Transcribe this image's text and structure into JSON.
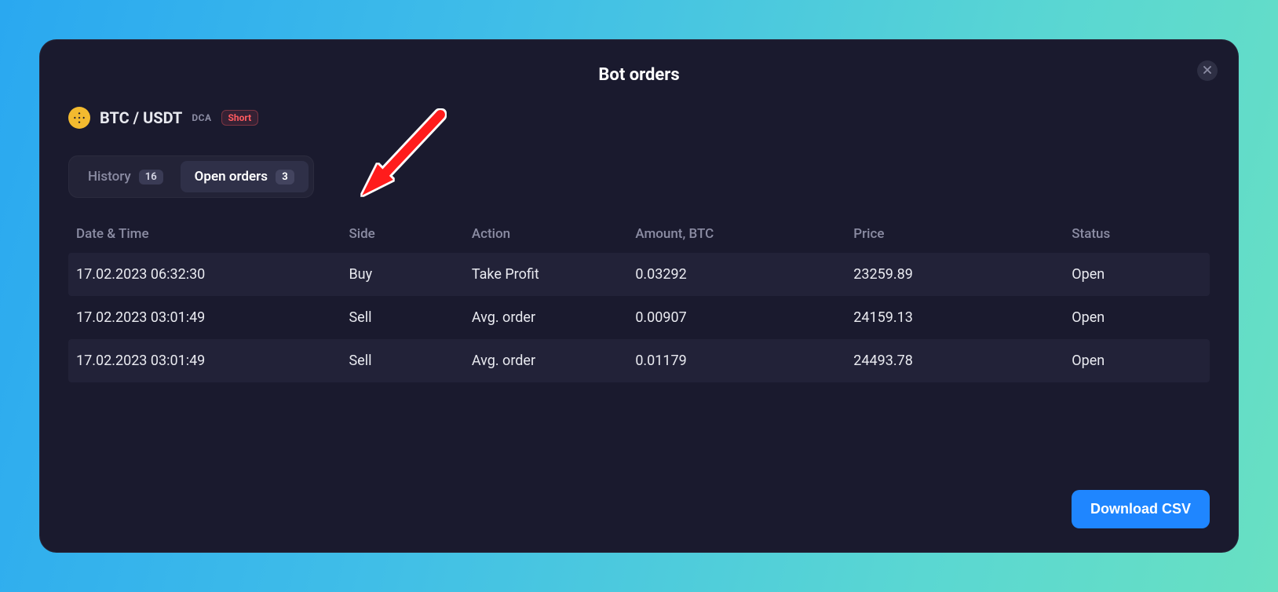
{
  "modal": {
    "title": "Bot orders"
  },
  "pair": {
    "symbol": "BTC / USDT",
    "type": "DCA",
    "direction": "Short"
  },
  "tabs": {
    "history": {
      "label": "History",
      "count": "16"
    },
    "open": {
      "label": "Open orders",
      "count": "3"
    }
  },
  "table": {
    "headers": {
      "datetime": "Date & Time",
      "side": "Side",
      "action": "Action",
      "amount": "Amount, BTC",
      "price": "Price",
      "status": "Status"
    },
    "rows": [
      {
        "datetime": "17.02.2023 06:32:30",
        "side": "Buy",
        "action": "Take Profit",
        "amount": "0.03292",
        "price": "23259.89",
        "status": "Open"
      },
      {
        "datetime": "17.02.2023 03:01:49",
        "side": "Sell",
        "action": "Avg. order",
        "amount": "0.00907",
        "price": "24159.13",
        "status": "Open"
      },
      {
        "datetime": "17.02.2023 03:01:49",
        "side": "Sell",
        "action": "Avg. order",
        "amount": "0.01179",
        "price": "24493.78",
        "status": "Open"
      }
    ]
  },
  "buttons": {
    "download": "Download CSV"
  }
}
